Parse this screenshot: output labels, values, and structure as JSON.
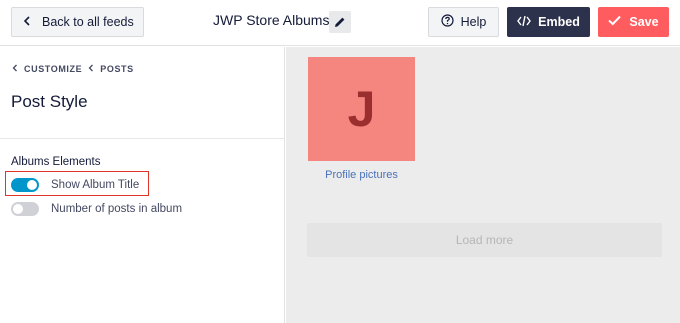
{
  "header": {
    "back_label": "Back to all feeds",
    "title": "JWP Store Albums",
    "help_label": "Help",
    "embed_label": "Embed",
    "save_label": "Save"
  },
  "sidebar": {
    "breadcrumb": [
      "CUSTOMIZE",
      "POSTS"
    ],
    "page_title": "Post Style",
    "section_label": "Albums Elements",
    "options": [
      {
        "label": "Show Album Title",
        "enabled": true
      },
      {
        "label": "Number of posts in album",
        "enabled": false
      }
    ]
  },
  "preview": {
    "album_letter": "J",
    "album_title": "Profile pictures",
    "load_more_label": "Load more"
  },
  "colors": {
    "embed_bg": "#2c324c",
    "save_bg": "#ff5c5f",
    "toggle_on": "#0096cc",
    "highlight": "#e0352b",
    "album_bg": "#f5857f"
  },
  "icons": {
    "back": "chevron-left-icon",
    "edit": "pencil-icon",
    "help": "question-circle-icon",
    "embed": "code-icon",
    "save": "checkmark-icon"
  }
}
